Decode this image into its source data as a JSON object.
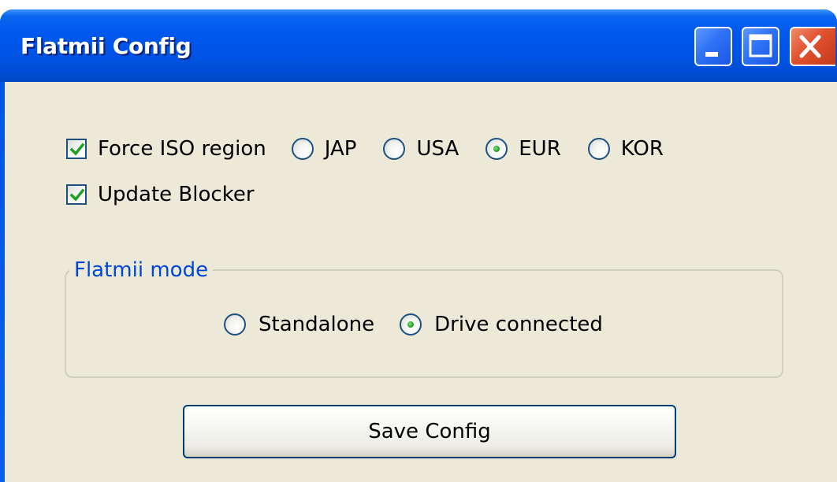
{
  "window": {
    "title": "Flatmii Config"
  },
  "options": {
    "force_iso": {
      "label": "Force ISO region",
      "checked": true
    },
    "regions": [
      {
        "label": "JAP",
        "selected": false
      },
      {
        "label": "USA",
        "selected": false
      },
      {
        "label": "EUR",
        "selected": true
      },
      {
        "label": "KOR",
        "selected": false
      }
    ],
    "update_blocker": {
      "label": "Update Blocker",
      "checked": true
    }
  },
  "mode_group": {
    "title": "Flatmii mode",
    "options": [
      {
        "label": "Standalone",
        "selected": false
      },
      {
        "label": "Drive connected",
        "selected": true
      }
    ]
  },
  "save_button": {
    "label": "Save Config"
  },
  "colors": {
    "titlebar": "#0054e3",
    "client_bg": "#ece9d8",
    "group_title": "#0046d5",
    "check_green": "#21a121",
    "close_red": "#e0512e"
  },
  "icons": {
    "minimize": "minimize-icon",
    "maximize": "maximize-icon",
    "close": "close-icon",
    "check": "checkmark-icon",
    "radio_dot": "radio-dot-icon"
  }
}
